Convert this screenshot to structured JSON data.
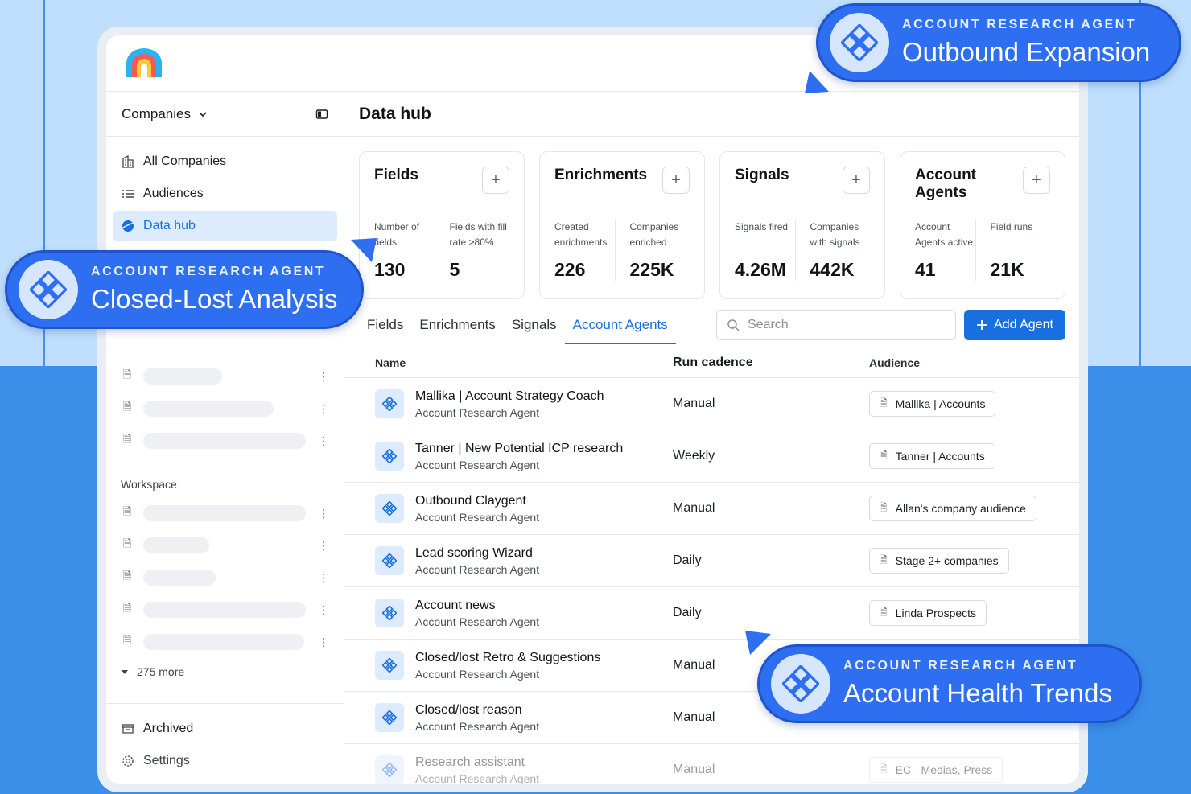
{
  "sidebar": {
    "header_label": "Companies",
    "nav": [
      {
        "label": "All Companies",
        "icon": "building-icon"
      },
      {
        "label": "Audiences",
        "icon": "list-icon"
      },
      {
        "label": "Data hub",
        "icon": "globe-icon",
        "active": true
      }
    ],
    "workspace_label": "Workspace",
    "more_label": "275 more",
    "footer": [
      {
        "label": "Archived",
        "icon": "archive-icon"
      },
      {
        "label": "Settings",
        "icon": "gear-icon"
      }
    ]
  },
  "main": {
    "title": "Data hub",
    "cards": [
      {
        "title": "Fields",
        "stats": [
          {
            "label": "Number of fields",
            "value": "130"
          },
          {
            "label": "Fields with fill rate >80%",
            "value": "5"
          }
        ]
      },
      {
        "title": "Enrichments",
        "stats": [
          {
            "label": "Created enrichments",
            "value": "226"
          },
          {
            "label": "Companies enriched",
            "value": "225K"
          }
        ]
      },
      {
        "title": "Signals",
        "stats": [
          {
            "label": "Signals fired",
            "value": "4.26M"
          },
          {
            "label": "Companies with signals",
            "value": "442K"
          }
        ]
      },
      {
        "title": "Account Agents",
        "stats": [
          {
            "label": "Account Agents active",
            "value": "41"
          },
          {
            "label": "Field runs",
            "value": "21K"
          }
        ]
      }
    ],
    "tabs": [
      {
        "label": "Fields"
      },
      {
        "label": "Enrichments"
      },
      {
        "label": "Signals"
      },
      {
        "label": "Account Agents",
        "active": true
      }
    ],
    "search_placeholder": "Search",
    "add_button_label": "Add Agent",
    "table": {
      "headers": [
        "Name",
        "Run cadence",
        "Audience"
      ],
      "rows": [
        {
          "name": "Mallika | Account Strategy Coach",
          "type": "Account Research Agent",
          "cadence": "Manual",
          "audience": "Mallika | Accounts"
        },
        {
          "name": "Tanner | New Potential ICP research",
          "type": "Account Research Agent",
          "cadence": "Weekly",
          "audience": "Tanner | Accounts"
        },
        {
          "name": "Outbound Claygent",
          "type": "Account Research Agent",
          "cadence": "Manual",
          "audience": "Allan's company audience"
        },
        {
          "name": "Lead scoring Wizard",
          "type": "Account Research Agent",
          "cadence": "Daily",
          "audience": "Stage 2+ companies"
        },
        {
          "name": "Account news",
          "type": "Account Research Agent",
          "cadence": "Daily",
          "audience": "Linda Prospects"
        },
        {
          "name": "Closed/lost Retro & Suggestions",
          "type": "Account Research Agent",
          "cadence": "Manual",
          "audience": ""
        },
        {
          "name": "Closed/lost reason",
          "type": "Account Research Agent",
          "cadence": "Manual",
          "audience": ""
        },
        {
          "name": "Research assistant",
          "type": "Account Research Agent",
          "cadence": "Manual",
          "audience": "EC - Medias, Press"
        }
      ]
    }
  },
  "badges": [
    {
      "eyebrow": "ACCOUNT RESEARCH AGENT",
      "title": "Outbound Expansion"
    },
    {
      "eyebrow": "ACCOUNT RESEARCH AGENT",
      "title": "Closed-Lost Analysis"
    },
    {
      "eyebrow": "ACCOUNT RESEARCH AGENT",
      "title": "Account Health Trends"
    }
  ],
  "colors": {
    "accent": "#1a6fe0",
    "badge_blue": "#2e6ff2",
    "background_blue": "#3b8fe8"
  }
}
